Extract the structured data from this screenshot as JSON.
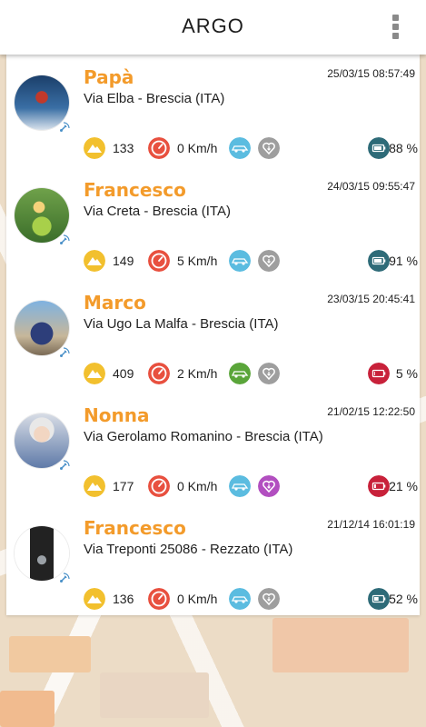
{
  "app": {
    "title": "ARGO"
  },
  "devices": [
    {
      "name": "Papà",
      "timestamp": "25/03/15 08:57:49",
      "address": "Via Elba - Brescia (ITA)",
      "altitude": "133",
      "speed": "0 Km/h",
      "battery": "88 %",
      "car_color": "#5bbce0",
      "heart_color": "#9e9e9e",
      "battery_color": "#2e6b78",
      "avatar": "man-on-ladder-photo"
    },
    {
      "name": "Francesco",
      "timestamp": "24/03/15 09:55:47",
      "address": "Via Creta - Brescia (ITA)",
      "altitude": "149",
      "speed": "5 Km/h",
      "battery": "91 %",
      "car_color": "#5bbce0",
      "heart_color": "#9e9e9e",
      "battery_color": "#2e6b78",
      "avatar": "child-on-bike-photo"
    },
    {
      "name": "Marco",
      "timestamp": "23/03/15 20:45:41",
      "address": "Via Ugo La Malfa - Brescia (ITA)",
      "altitude": "409",
      "speed": "2 Km/h",
      "battery": "5 %",
      "car_color": "#5aa53a",
      "heart_color": "#9e9e9e",
      "battery_color": "#c8213a",
      "avatar": "quad-bike-photo"
    },
    {
      "name": "Nonna",
      "timestamp": "21/02/15 12:22:50",
      "address": "Via Gerolamo Romanino - Brescia (ITA)",
      "altitude": "177",
      "speed": "0 Km/h",
      "battery": "21 %",
      "car_color": "#5bbce0",
      "heart_color": "#b24fc0",
      "battery_color": "#c8213a",
      "avatar": "grandmother-photo"
    },
    {
      "name": "Francesco",
      "timestamp": "21/12/14 16:01:19",
      "address": "Via Treponti 25086 - Rezzato (ITA)",
      "altitude": "136",
      "speed": "0 Km/h",
      "battery": "52 %",
      "car_color": "#5bbce0",
      "heart_color": "#9e9e9e",
      "battery_color": "#2e6b78",
      "avatar": "gps-tracker-device-photo"
    }
  ],
  "icons": {
    "altitude": "mountain-icon",
    "speed": "speedometer-icon",
    "car": "car-icon",
    "heart": "heart-icon",
    "battery": "battery-icon",
    "satellite": "satellite-icon",
    "menu": "overflow-menu-icon"
  },
  "colors": {
    "name_accent": "#f39b2b",
    "altitude_icon": "#f2c02e",
    "speed_icon": "#e8503f"
  }
}
